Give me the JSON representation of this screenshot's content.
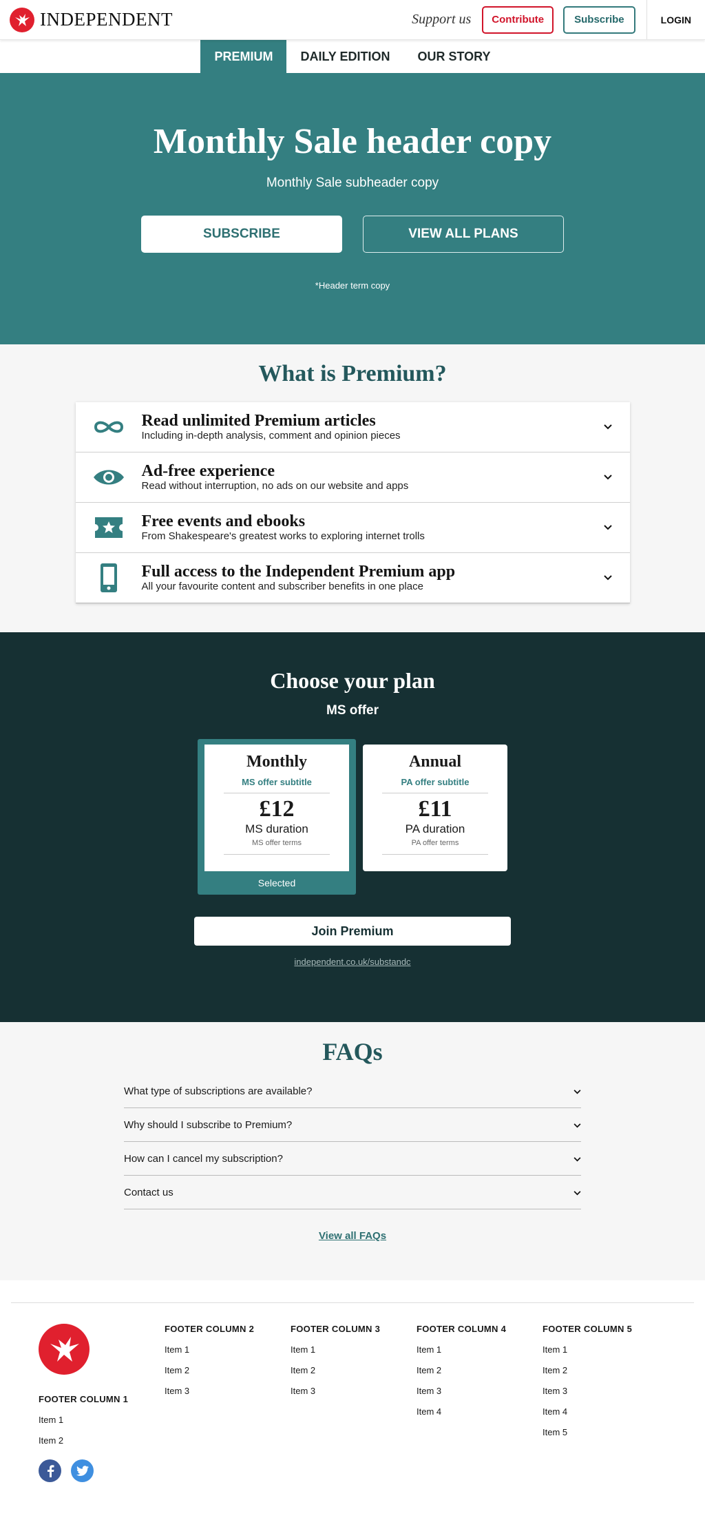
{
  "header": {
    "logo_text": "INDEPENDENT",
    "support": "Support us",
    "contribute": "Contribute",
    "subscribe": "Subscribe",
    "login": "LOGIN"
  },
  "tabs": [
    {
      "label": "PREMIUM",
      "active": true
    },
    {
      "label": "DAILY EDITION",
      "active": false
    },
    {
      "label": "OUR STORY",
      "active": false
    }
  ],
  "hero": {
    "title": "Monthly Sale header copy",
    "subtitle": "Monthly Sale subheader copy",
    "subscribe_button": "SUBSCRIBE",
    "view_plans_button": "VIEW ALL PLANS",
    "terms": "*Header term copy"
  },
  "premium": {
    "title": "What is Premium?",
    "features": [
      {
        "icon": "infinity-icon",
        "title": "Read unlimited Premium articles",
        "desc": "Including in-depth analysis, comment and opinion pieces"
      },
      {
        "icon": "eye-icon",
        "title": "Ad-free experience",
        "desc": "Read without interruption, no ads on our website and apps"
      },
      {
        "icon": "ticket-star-icon",
        "title": "Free events and ebooks",
        "desc": "From Shakespeare's greatest works to exploring internet trolls"
      },
      {
        "icon": "phone-icon",
        "title": "Full access to the Independent Premium app",
        "desc": "All your favourite content and subscriber benefits in one place"
      }
    ]
  },
  "plans": {
    "title": "Choose your plan",
    "offer": "MS offer",
    "items": [
      {
        "name": "Monthly",
        "subtitle": "MS offer subtitle",
        "price": "£12",
        "duration": "MS duration",
        "terms": "MS offer terms"
      },
      {
        "name": "Annual",
        "subtitle": "PA offer subtitle",
        "price": "£11",
        "duration": "PA duration",
        "terms": "PA offer terms"
      }
    ],
    "selected_label": "Selected",
    "join": "Join Premium",
    "tandc": "independent.co.uk/substandc"
  },
  "faq": {
    "title": "FAQs",
    "items": [
      "What type of subscriptions are available?",
      "Why should I subscribe to Premium?",
      "How can I cancel my subscription?",
      "Contact us"
    ],
    "view_all": "View all FAQs"
  },
  "footer": {
    "col1": {
      "title": "FOOTER COLUMN 1",
      "items": [
        "Item 1",
        "Item 2"
      ]
    },
    "col2": {
      "title": "FOOTER COLUMN 2",
      "items": [
        "Item 1",
        "Item 2",
        "Item 3"
      ]
    },
    "col3": {
      "title": "FOOTER COLUMN 3",
      "items": [
        "Item 1",
        "Item 2",
        "Item 3"
      ]
    },
    "col4": {
      "title": "FOOTER COLUMN 4",
      "items": [
        "Item 1",
        "Item 2",
        "Item 3",
        "Item 4"
      ]
    },
    "col5": {
      "title": "FOOTER COLUMN 5",
      "items": [
        "Item 1",
        "Item 2",
        "Item 3",
        "Item 4",
        "Item 5"
      ]
    }
  },
  "colors": {
    "teal": "#347f81",
    "dark_teal": "#163033",
    "brand_red": "#e0202e"
  }
}
